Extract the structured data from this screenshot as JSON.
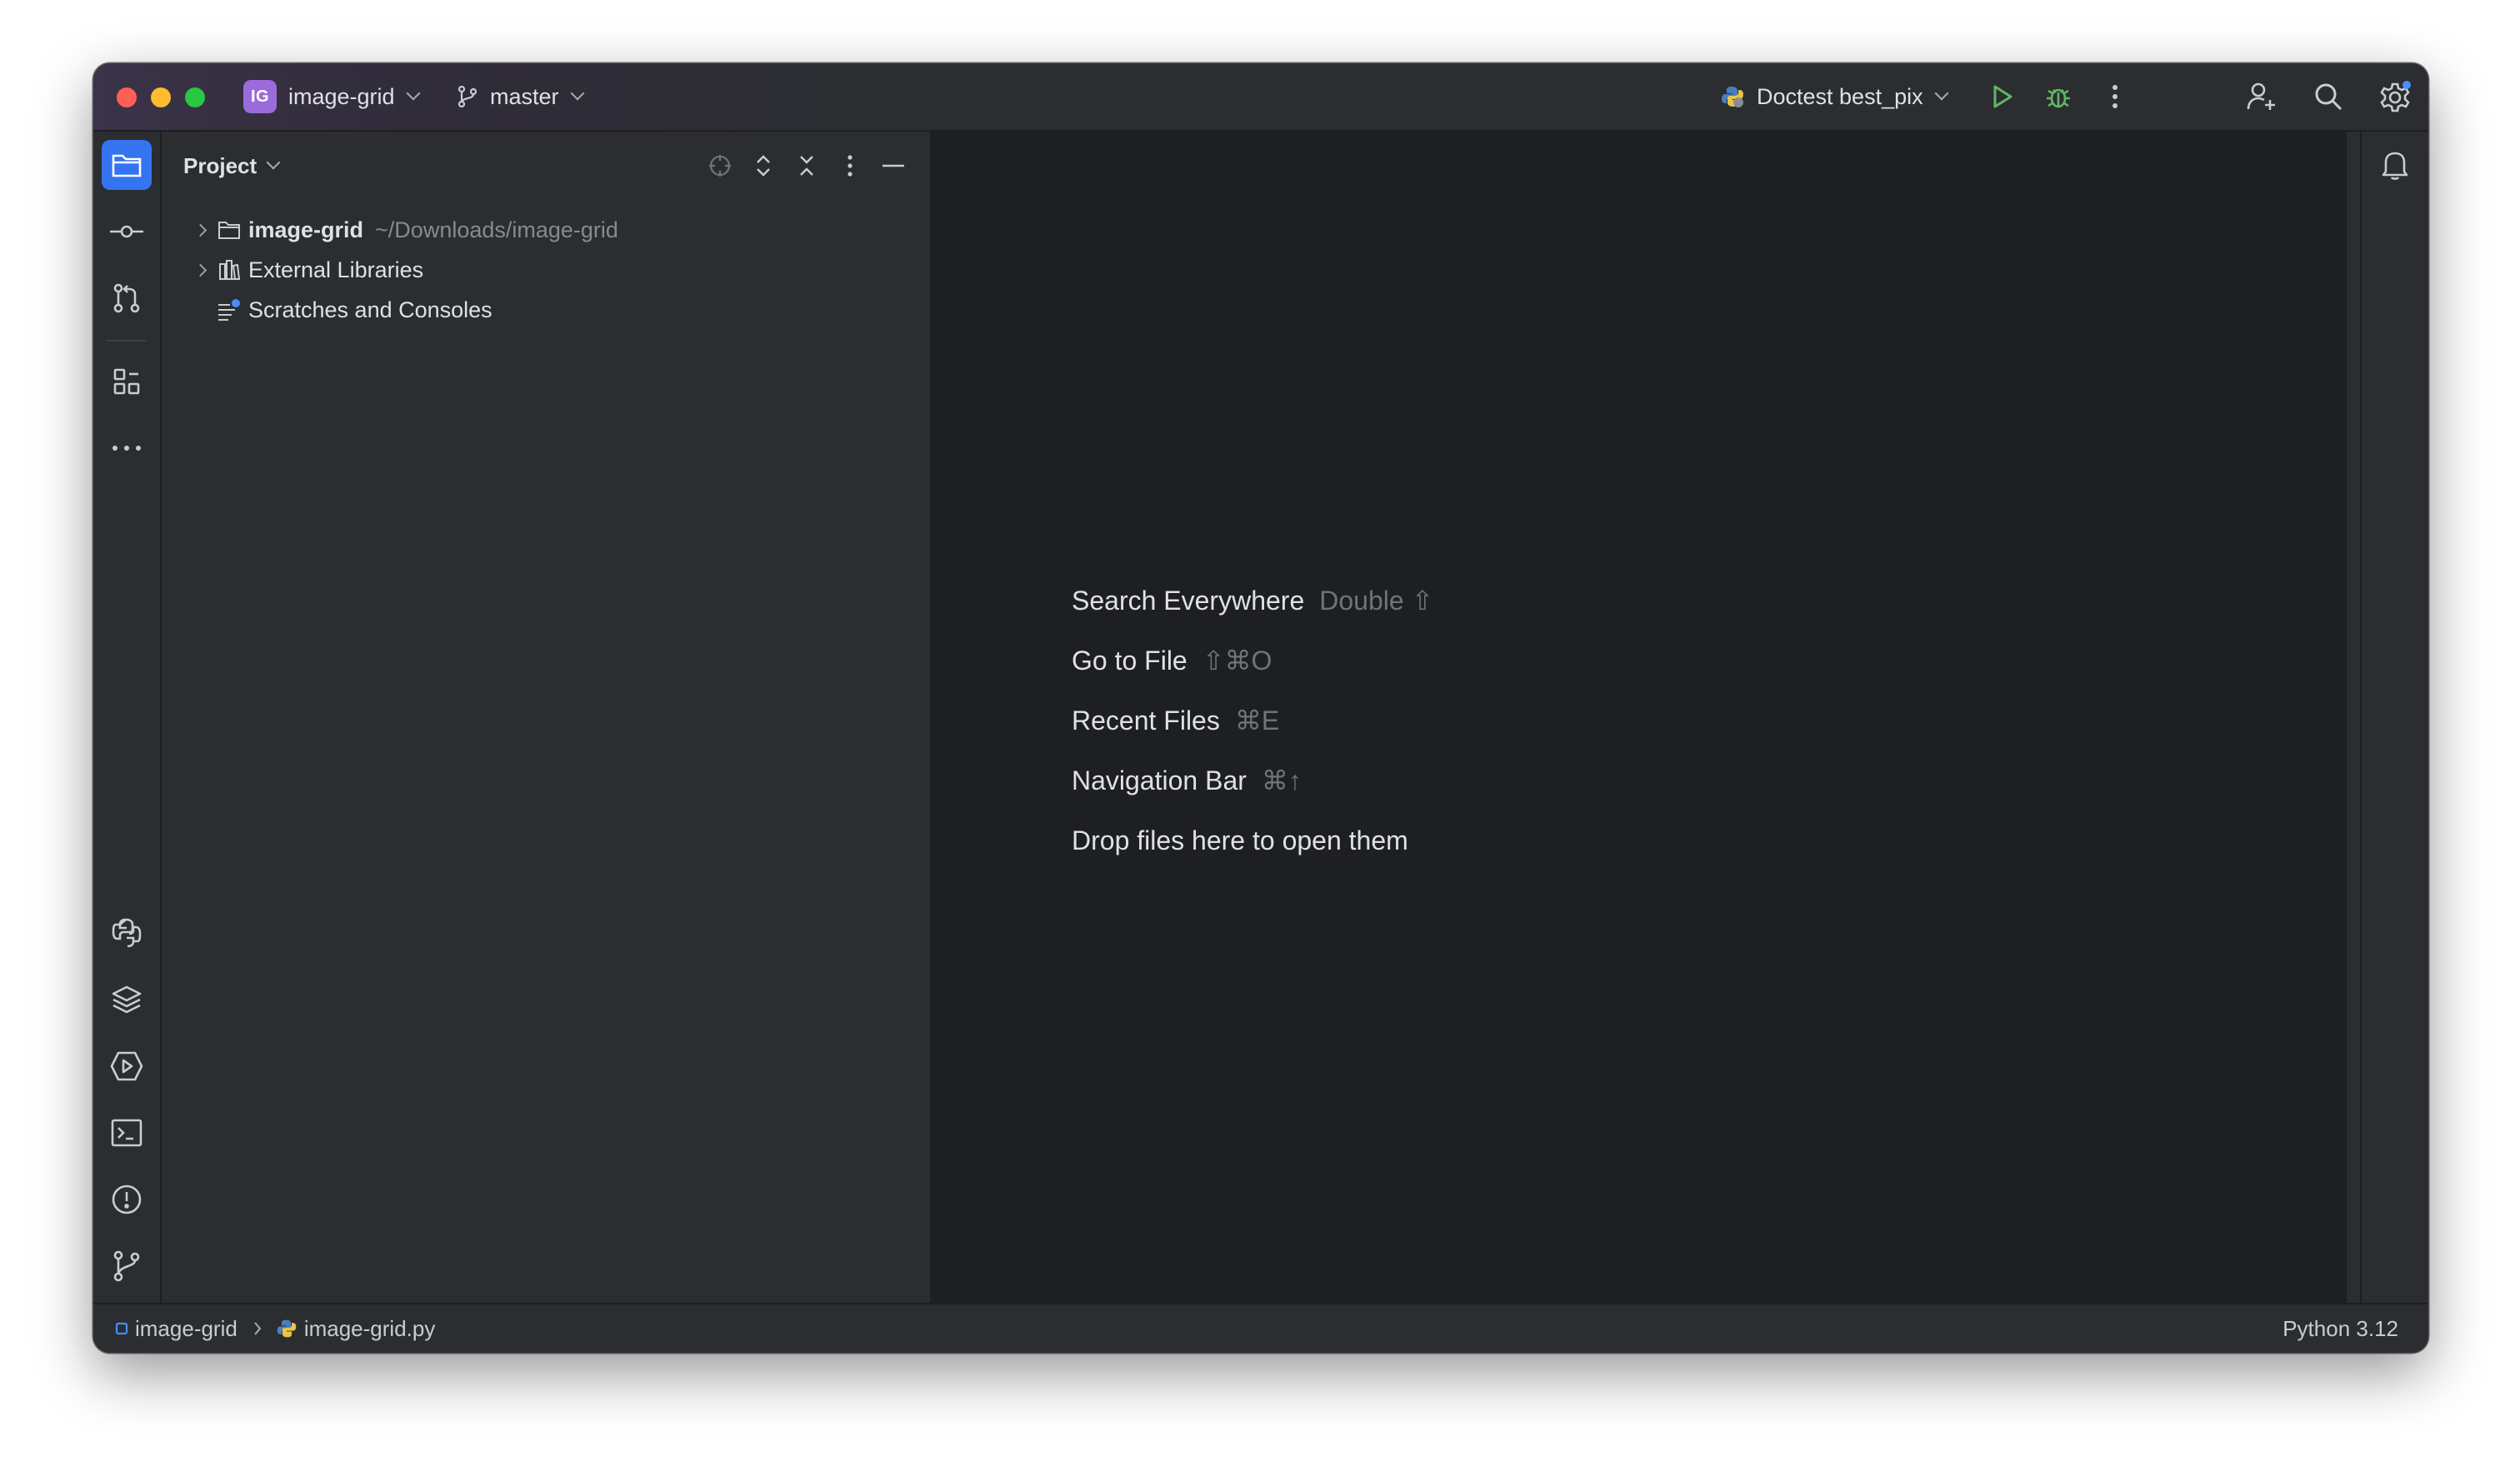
{
  "titlebar": {
    "project_badge": "IG",
    "project_name": "image-grid",
    "branch": "master",
    "run_config": "Doctest best_pix"
  },
  "left_toolbar": {
    "top_icons": [
      "folder-icon",
      "commit-icon",
      "pull-requests-icon",
      "structure-icon",
      "more-icon"
    ],
    "bottom_icons": [
      "python-console-icon",
      "layers-icon",
      "services-icon",
      "terminal-icon",
      "problems-icon",
      "git-icon"
    ]
  },
  "project_panel": {
    "title": "Project",
    "tree": [
      {
        "label": "image-grid",
        "path": "~/Downloads/image-grid",
        "expandable": true,
        "icon": "folder-icon"
      },
      {
        "label": "External Libraries",
        "expandable": true,
        "icon": "library-icon"
      },
      {
        "label": "Scratches and Consoles",
        "expandable": false,
        "icon": "scratches-icon"
      }
    ]
  },
  "editor_hints": [
    {
      "label": "Search Everywhere",
      "shortcut": "Double ⇧"
    },
    {
      "label": "Go to File",
      "shortcut": "⇧⌘O"
    },
    {
      "label": "Recent Files",
      "shortcut": "⌘E"
    },
    {
      "label": "Navigation Bar",
      "shortcut": "⌘↑"
    },
    {
      "label": "Drop files here to open them",
      "shortcut": ""
    }
  ],
  "statusbar": {
    "breadcrumb_project": "image-grid",
    "breadcrumb_file": "image-grid.py",
    "interpreter": "Python 3.12"
  },
  "colors": {
    "accent": "#3574f0",
    "project_badge": "#9b6bdc",
    "run_green": "#5fb865",
    "notification_dot": "#4a8cff"
  }
}
